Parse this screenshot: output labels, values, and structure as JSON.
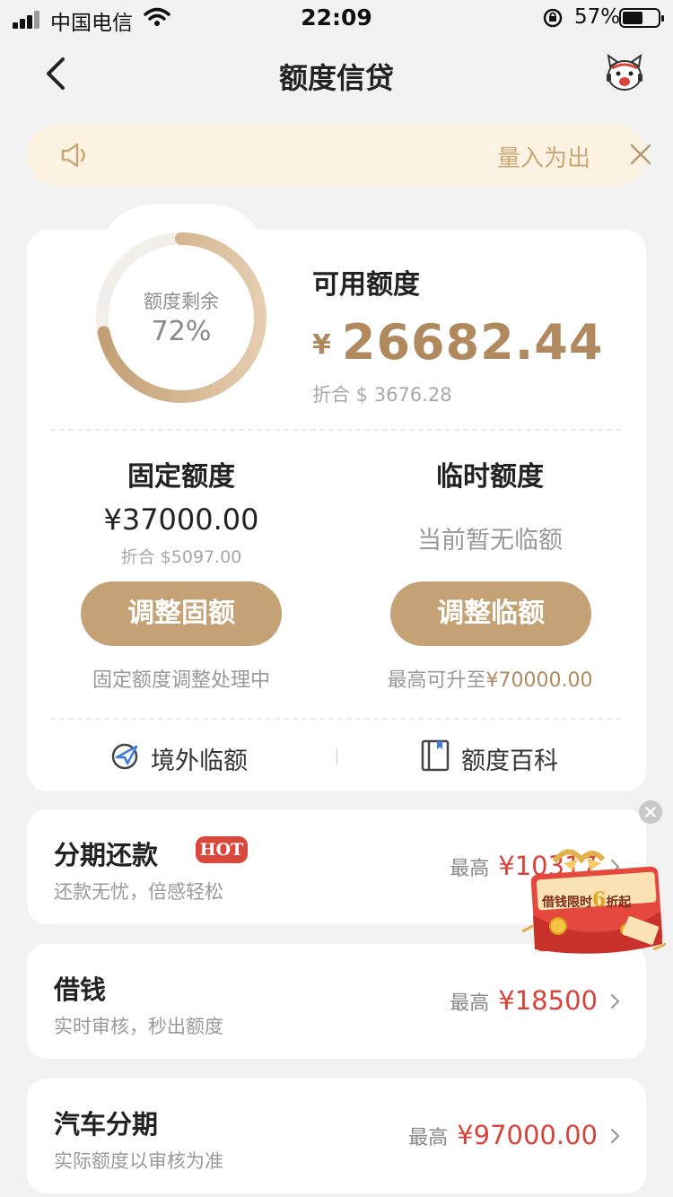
{
  "status_bar": {
    "carrier": "中国电信",
    "time": "22:09",
    "battery_percent": "57%"
  },
  "nav": {
    "title": "额度信贷"
  },
  "notice": {
    "marquee_text": "量入为出"
  },
  "quota": {
    "ring_label": "额度剩余",
    "ring_percent_text": "72%",
    "ring_fraction": 0.72,
    "available_label": "可用额度",
    "available_currency": "¥",
    "available_amount": "26682.44",
    "available_usd": "折合 $ 3676.28"
  },
  "fixed": {
    "title": "固定额度",
    "amount": "¥37000.00",
    "usd": "折合 $5097.00",
    "button_label": "调整固额",
    "status": "固定额度调整处理中"
  },
  "temporary": {
    "title": "临时额度",
    "none_text": "当前暂无临额",
    "button_label": "调整临额",
    "max_prefix": "最高可升至",
    "max_value": "¥70000.00"
  },
  "links": {
    "overseas": "境外临额",
    "encyclopedia": "额度百科"
  },
  "products": [
    {
      "title": "分期还款",
      "badge": "HOT",
      "subtitle": "还款无忧，倍感轻松",
      "max_label": "最高",
      "max_value": "¥10317"
    },
    {
      "title": "借钱",
      "subtitle": "实时审核，秒出额度",
      "max_label": "最高",
      "max_value": "¥18500"
    },
    {
      "title": "汽车分期",
      "subtitle": "实际额度以审核为准",
      "max_label": "最高",
      "max_value": "¥97000.00"
    }
  ],
  "promo": {
    "text_a": "借钱限时",
    "text_num": "6",
    "text_b": "折起"
  },
  "colors": {
    "accent_gold": "#c4a276",
    "amount_gold": "#b08a5e",
    "price_red": "#d8443b",
    "notice_bg": "#fbf2e2"
  }
}
